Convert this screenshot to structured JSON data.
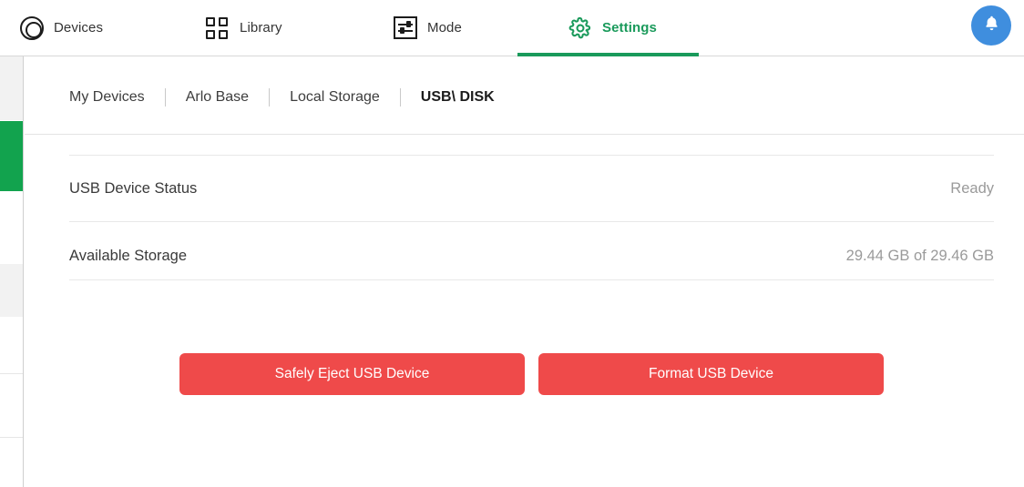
{
  "topnav": {
    "items": [
      {
        "label": "Devices",
        "icon": "camera-lens-icon",
        "active": false
      },
      {
        "label": "Library",
        "icon": "grid-icon",
        "active": false
      },
      {
        "label": "Mode",
        "icon": "sliders-icon",
        "active": false
      },
      {
        "label": "Settings",
        "icon": "gear-icon",
        "active": true
      }
    ],
    "notification_icon": "bell-icon",
    "active_color": "#1a9a5b",
    "notification_bg": "#3f8ede"
  },
  "breadcrumb": {
    "items": [
      {
        "label": "My Devices",
        "current": false
      },
      {
        "label": "Arlo Base",
        "current": false
      },
      {
        "label": "Local Storage",
        "current": false
      },
      {
        "label": "USB\\ DISK",
        "current": true
      }
    ]
  },
  "main": {
    "rows": [
      {
        "label": "USB Device Status",
        "value": "Ready"
      },
      {
        "label": "Available Storage",
        "value": "29.44 GB of 29.46 GB"
      }
    ],
    "buttons": [
      {
        "label": "Safely Eject USB Device",
        "color": "#ef4a4a"
      },
      {
        "label": "Format USB Device",
        "color": "#ef4a4a"
      }
    ]
  },
  "sidebar": {
    "selected_color": "#12a34e"
  }
}
